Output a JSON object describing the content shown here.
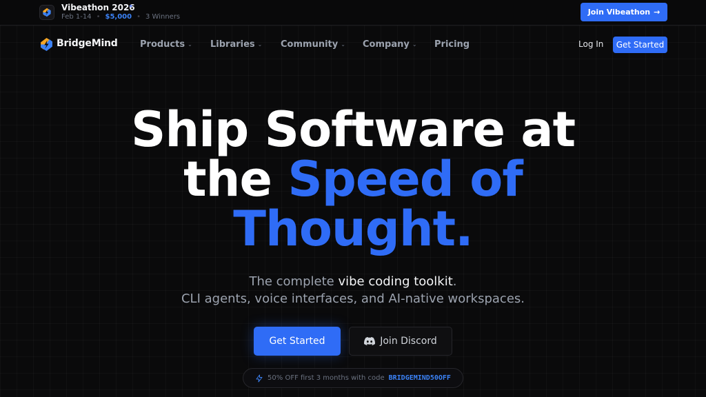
{
  "announcement": {
    "title": "Vibeathon 2026",
    "dates": "Feb 1-14",
    "prize": "$5,000",
    "winners": "3 Winners",
    "cta_label": "Join Vibeathon",
    "cta_arrow": "→"
  },
  "nav": {
    "brand": "BridgeMind",
    "items": [
      {
        "label": "Products",
        "has_dropdown": true
      },
      {
        "label": "Libraries",
        "has_dropdown": true
      },
      {
        "label": "Community",
        "has_dropdown": true
      },
      {
        "label": "Company",
        "has_dropdown": true
      },
      {
        "label": "Pricing",
        "has_dropdown": false
      }
    ],
    "login_label": "Log In",
    "get_started_label": "Get Started"
  },
  "hero": {
    "line1": "Ship Software at",
    "line2_plain": "the ",
    "line2_accent": "Speed of",
    "line3_accent": "Thought."
  },
  "subheadline": {
    "part1": "The complete ",
    "highlight": "vibe coding toolkit",
    "part2": ".",
    "line2": "CLI agents, voice interfaces, and AI-native workspaces."
  },
  "cta": {
    "primary_label": "Get Started",
    "secondary_label": "Join Discord"
  },
  "promo": {
    "text": "50% OFF first 3 months with code",
    "code": "BRIDGEMIND50OFF"
  },
  "colors": {
    "accent": "#2f6cf6",
    "background": "#0a0a0b",
    "logo_orange": "#f5a524",
    "logo_blue": "#3b82f6"
  },
  "icons": {
    "logo": "bridgemind-bolt-icon",
    "sparkle": "sparkle-icon",
    "discord": "discord-icon",
    "promo": "lightning-icon"
  }
}
